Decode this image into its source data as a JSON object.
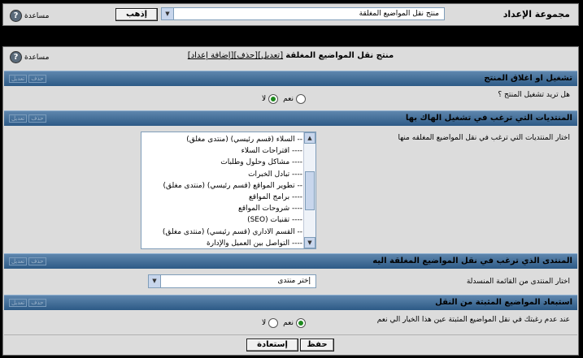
{
  "top": {
    "group_label": "مجموعة الإعداد",
    "select_value": "منتج نقل المواضيع المغلقة",
    "go_button": "إذهب",
    "help": "مساعدة"
  },
  "main": {
    "title": "منتج نقل المواضيع المغلقة",
    "title_links": [
      "[تعديل]",
      "[حذف]",
      "[إضافة إعداد]"
    ],
    "help": "مساعدة",
    "edit_del": [
      "تعديل",
      "حذف"
    ],
    "sections": [
      {
        "title": "تشغيل او اغلاق المنتج",
        "question": "هل تريد تشغيل المنتج ؟",
        "yes": "نعم",
        "no": "لا",
        "selected": "no"
      },
      {
        "title": "المنتديات التي ترغب في تشغيل الهاك بها",
        "question": "اختار المنتديات التي ترغب في نقل المواضيع المغلقه منها",
        "list": [
          "-- السلاء (قسم رئيسي) (منتدى مغلق)",
          "---- اقتراحات السلاء",
          "---- مشاكل وحلول وطلبات",
          "---- تبادل الخبرات",
          "-- تطوير المواقع (قسم رئيسي) (منتدى مغلق)",
          "---- برامج المواقع",
          "---- شروحات المواقع",
          "---- تقنيات (SEO)",
          "-- القسم الاداري (قسم رئيسي) (منتدى مغلق)",
          "---- التواصل بين العميل والإدارة"
        ]
      },
      {
        "title": "المنتدى الذي ترغب في نقل المواضيع المغلقة اليه",
        "question": "اختار المنتدى من القائمة المنسدلة",
        "select_value": "إختر منتدى"
      },
      {
        "title": "استبعاد المواضيع المثبتة من النقل",
        "question": "عند عدم رغبتك في نقل المواضيع المثبتة عين هذا الخيار الي نعم",
        "yes": "نعم",
        "no": "لا",
        "selected": "yes"
      }
    ],
    "save_button": "حفظ",
    "restore_button": "إستعادة"
  }
}
